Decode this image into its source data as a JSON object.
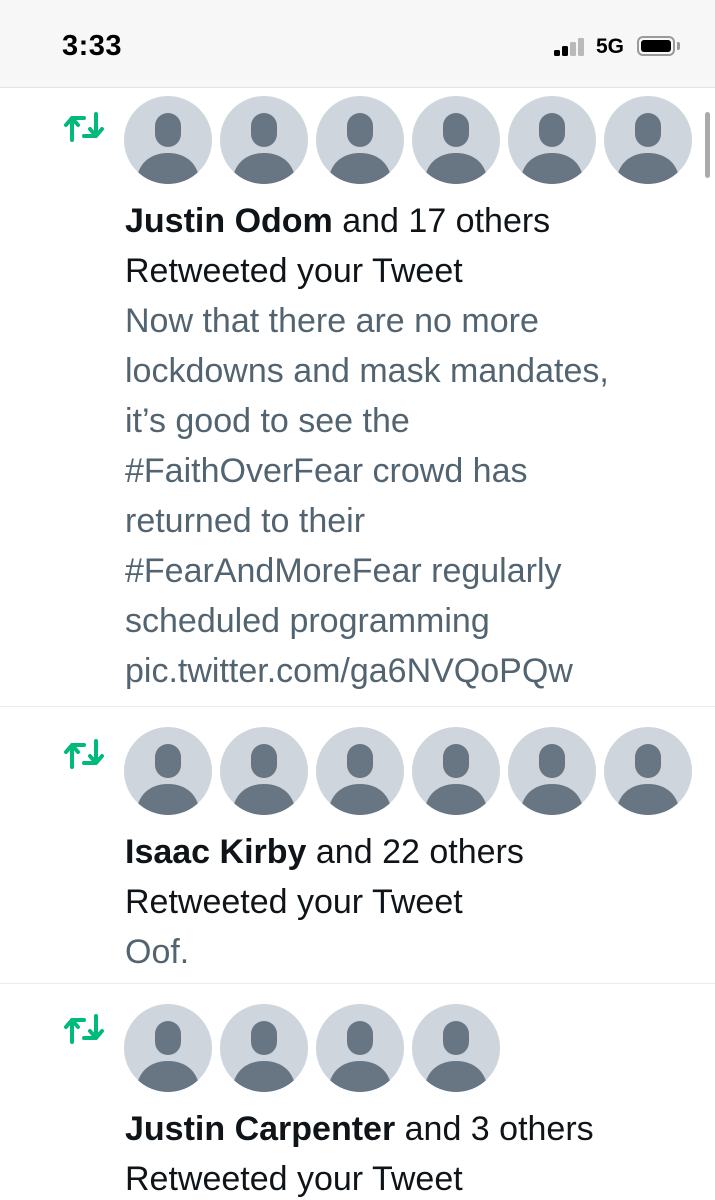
{
  "status_bar": {
    "time": "3:33",
    "network": "5G"
  },
  "notifications": [
    {
      "type_icon": "retweet-icon",
      "avatar_count": 6,
      "name": "Justin Odom",
      "others": " and 17 others",
      "action": "Retweeted your Tweet",
      "preview_lines": [
        "Now that there are no more",
        "lockdowns and mask mandates,",
        "it’s good to see the",
        "#FaithOverFear crowd has",
        "returned to their",
        "#FearAndMoreFear regularly",
        "scheduled programming",
        "pic.twitter.com/ga6NVQoPQw"
      ]
    },
    {
      "type_icon": "retweet-icon",
      "avatar_count": 6,
      "name": "Isaac Kirby",
      "others": " and 22 others",
      "action": "Retweeted your Tweet",
      "preview_lines": [
        "Oof."
      ]
    },
    {
      "type_icon": "retweet-icon",
      "avatar_count": 4,
      "name": "Justin Carpenter",
      "others": " and 3 others",
      "action": "Retweeted your Tweet",
      "preview_lines": []
    }
  ],
  "colors": {
    "retweet_green": "#00ba7c",
    "avatar_bg": "#ced5dc",
    "avatar_figure": "#687684",
    "preview_text": "#536471"
  }
}
